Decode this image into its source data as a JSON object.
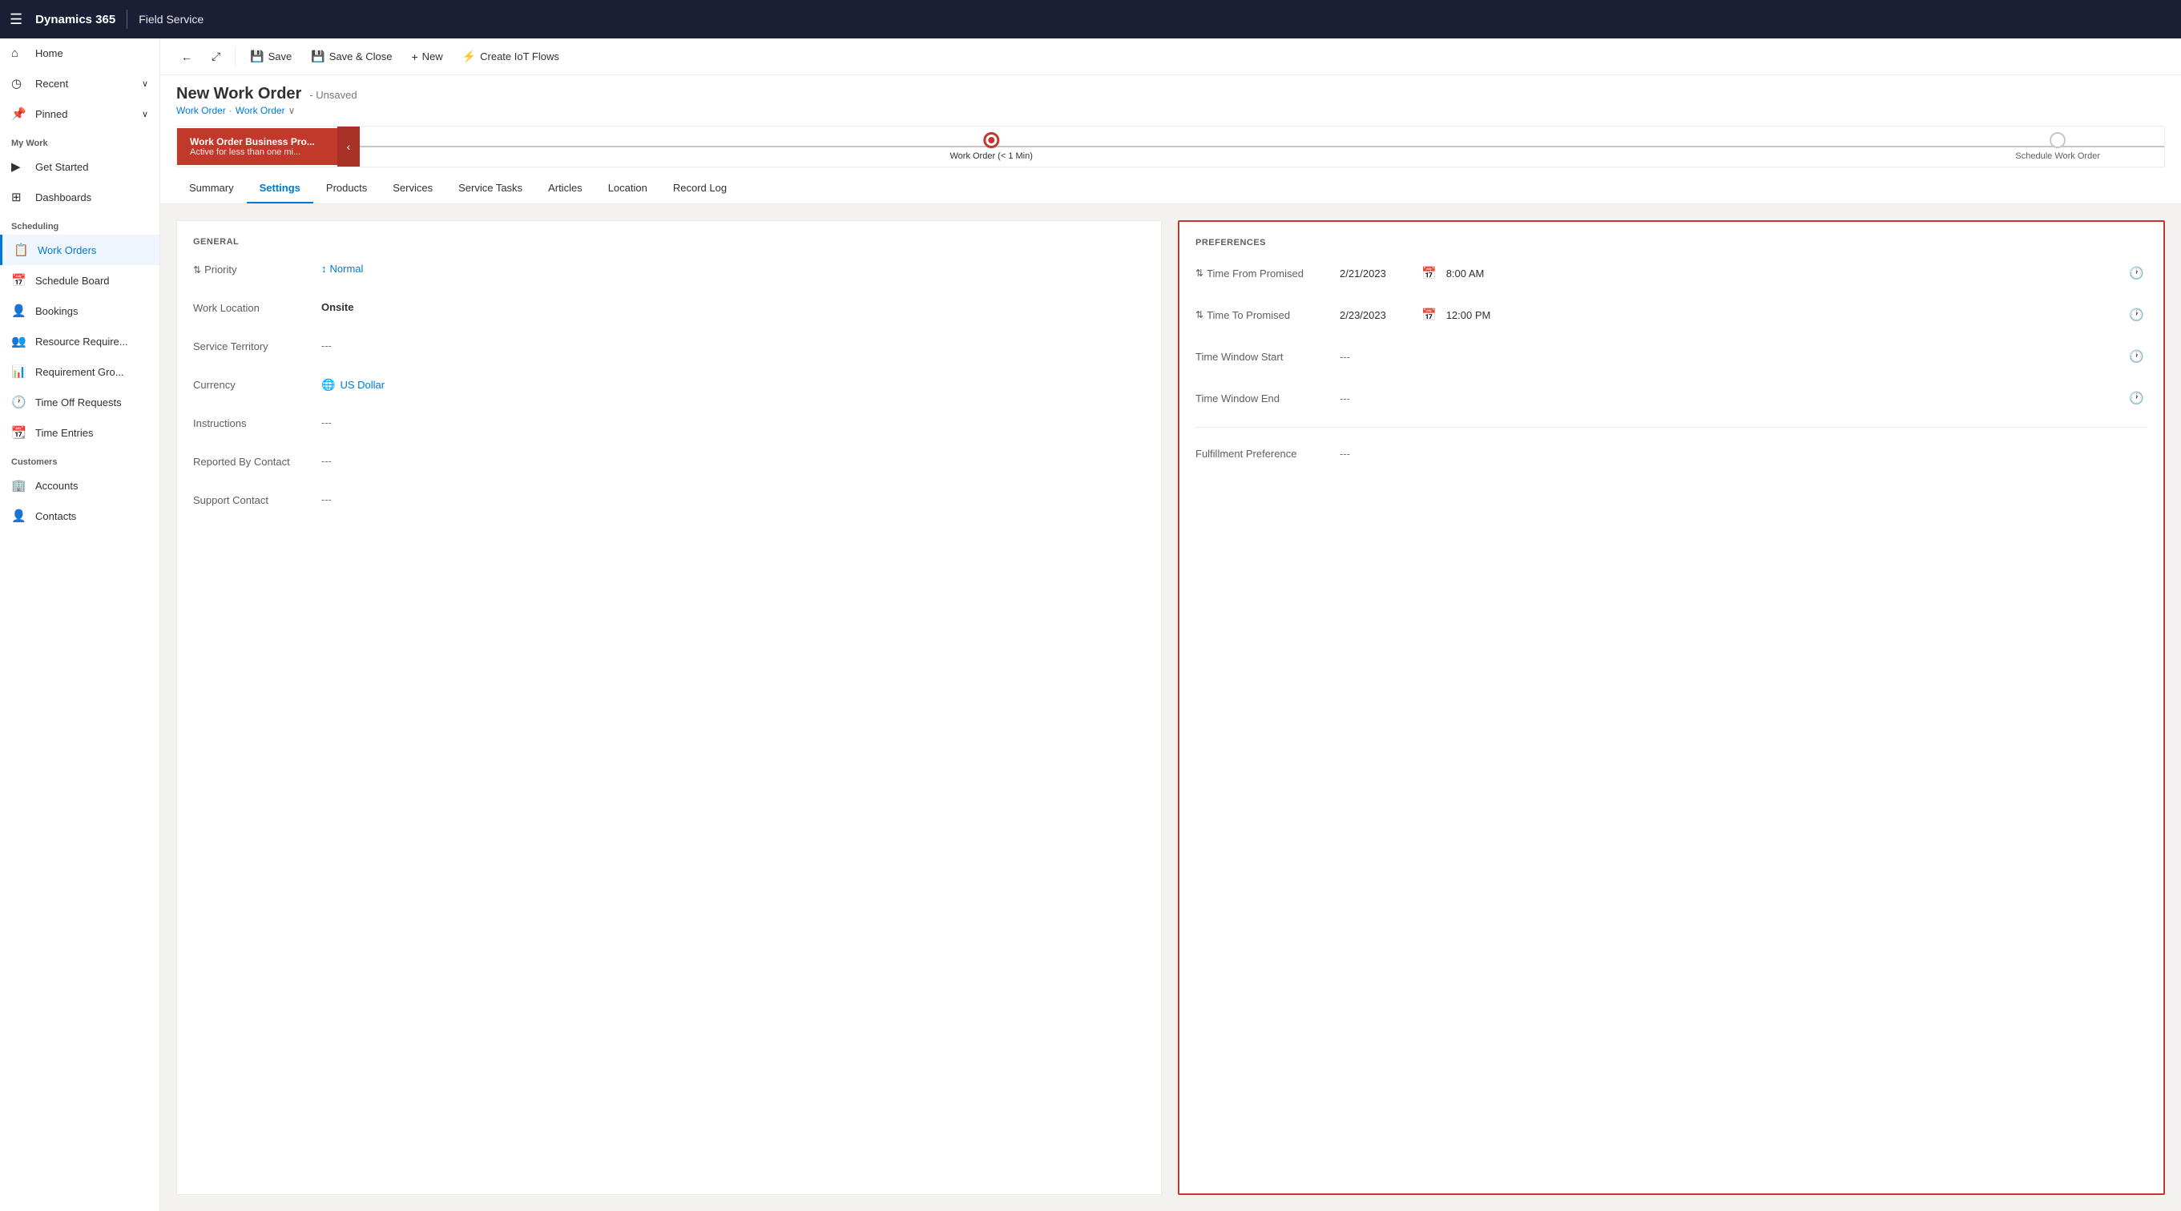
{
  "topNav": {
    "appName": "Dynamics 365",
    "moduleName": "Field Service"
  },
  "toolbar": {
    "backLabel": "",
    "popoutLabel": "",
    "saveLabel": "Save",
    "saveCloseLabel": "Save & Close",
    "newLabel": "New",
    "createIotLabel": "Create IoT Flows"
  },
  "pageHeader": {
    "title": "New Work Order",
    "status": "- Unsaved",
    "breadcrumb1": "Work Order",
    "breadcrumb2": "Work Order"
  },
  "processFlow": {
    "activeStage": "Work Order Business Pro...",
    "activeStageSub": "Active for less than one mi...",
    "node1Label": "Work Order (< 1 Min)",
    "node2Label": "Schedule Work Order"
  },
  "tabs": [
    {
      "id": "summary",
      "label": "Summary"
    },
    {
      "id": "settings",
      "label": "Settings"
    },
    {
      "id": "products",
      "label": "Products"
    },
    {
      "id": "services",
      "label": "Services"
    },
    {
      "id": "service-tasks",
      "label": "Service Tasks"
    },
    {
      "id": "articles",
      "label": "Articles"
    },
    {
      "id": "location",
      "label": "Location"
    },
    {
      "id": "record-log",
      "label": "Record Log"
    }
  ],
  "general": {
    "sectionTitle": "GENERAL",
    "fields": [
      {
        "label": "Priority",
        "value": "Normal",
        "type": "link",
        "hasIcon": true,
        "iconType": "priority"
      },
      {
        "label": "Work Location",
        "value": "Onsite",
        "type": "bold"
      },
      {
        "label": "Service Territory",
        "value": "---",
        "type": "empty"
      },
      {
        "label": "Currency",
        "value": "US Dollar",
        "type": "link",
        "hasIcon": true,
        "iconType": "currency"
      },
      {
        "label": "Instructions",
        "value": "---",
        "type": "empty"
      },
      {
        "label": "Reported By Contact",
        "value": "---",
        "type": "empty"
      },
      {
        "label": "Support Contact",
        "value": "---",
        "type": "empty"
      }
    ]
  },
  "preferences": {
    "sectionTitle": "PREFERENCES",
    "fields": [
      {
        "label": "Time From Promised",
        "hasIcon": true,
        "date": "2/21/2023",
        "time": "8:00 AM",
        "hasDateIcon": true,
        "hasTimeIcon": true
      },
      {
        "label": "Time To Promised",
        "hasIcon": true,
        "date": "2/23/2023",
        "time": "12:00 PM",
        "hasDateIcon": true,
        "hasTimeIcon": true
      },
      {
        "label": "Time Window Start",
        "hasIcon": false,
        "date": "",
        "time": "",
        "value": "---",
        "hasDateIcon": false,
        "hasTimeIcon": true
      },
      {
        "label": "Time Window End",
        "hasIcon": false,
        "date": "",
        "time": "",
        "value": "---",
        "hasDateIcon": false,
        "hasTimeIcon": true
      }
    ],
    "fulfillmentLabel": "Fulfillment Preference",
    "fulfillmentValue": "---"
  },
  "sidebar": {
    "navItems": [
      {
        "id": "home",
        "label": "Home",
        "icon": "⌂"
      },
      {
        "id": "recent",
        "label": "Recent",
        "icon": "◷",
        "hasChevron": true
      },
      {
        "id": "pinned",
        "label": "Pinned",
        "icon": "📌",
        "hasChevron": true
      }
    ],
    "myWorkTitle": "My Work",
    "myWorkItems": [
      {
        "id": "get-started",
        "label": "Get Started",
        "icon": "▶"
      },
      {
        "id": "dashboards",
        "label": "Dashboards",
        "icon": "⊞"
      }
    ],
    "schedulingTitle": "Scheduling",
    "schedulingItems": [
      {
        "id": "work-orders",
        "label": "Work Orders",
        "icon": "📋",
        "active": true
      },
      {
        "id": "schedule-board",
        "label": "Schedule Board",
        "icon": "📅"
      },
      {
        "id": "bookings",
        "label": "Bookings",
        "icon": "👤"
      },
      {
        "id": "resource-req",
        "label": "Resource Require...",
        "icon": "👥"
      },
      {
        "id": "requirement-gro",
        "label": "Requirement Gro...",
        "icon": "📊"
      },
      {
        "id": "time-off",
        "label": "Time Off Requests",
        "icon": "🕐"
      },
      {
        "id": "time-entries",
        "label": "Time Entries",
        "icon": "📆"
      }
    ],
    "customersTitle": "Customers",
    "customersItems": [
      {
        "id": "accounts",
        "label": "Accounts",
        "icon": "🏢"
      },
      {
        "id": "contacts",
        "label": "Contacts",
        "icon": "👤"
      }
    ]
  }
}
